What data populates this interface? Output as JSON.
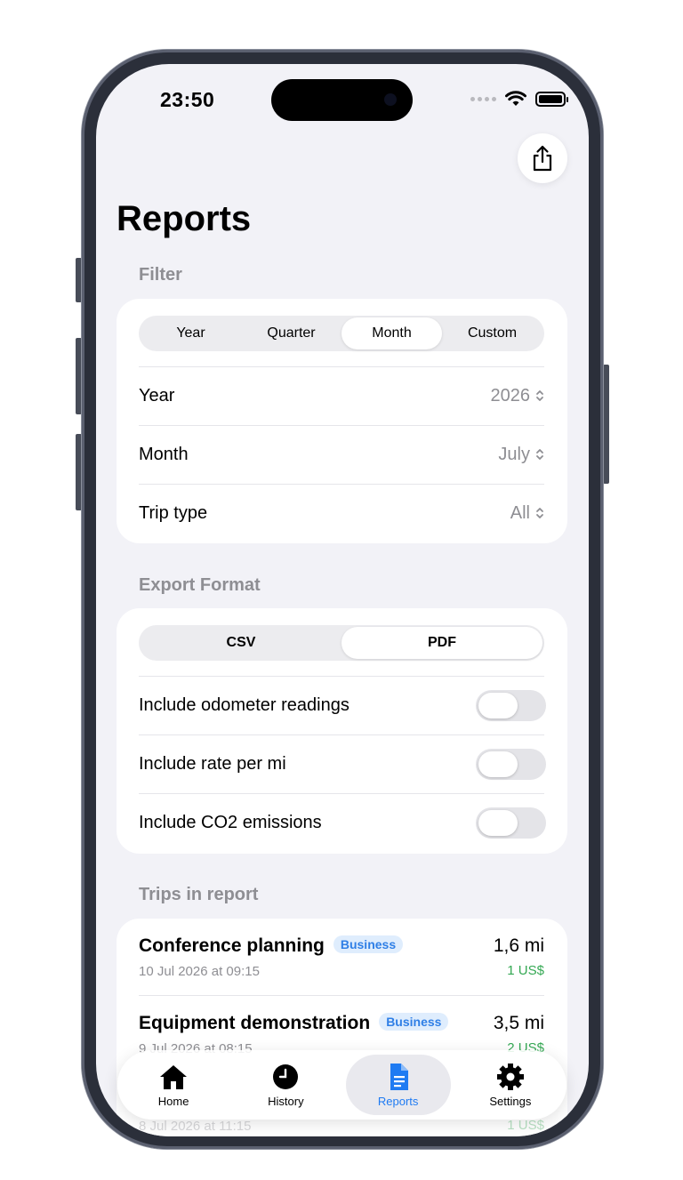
{
  "status_bar": {
    "time": "23:50"
  },
  "page": {
    "title": "Reports",
    "share_icon": "share-icon"
  },
  "filter": {
    "section_label": "Filter",
    "segments": [
      "Year",
      "Quarter",
      "Month",
      "Custom"
    ],
    "selected_segment": "Month",
    "rows": [
      {
        "label": "Year",
        "value": "2026"
      },
      {
        "label": "Month",
        "value": "July"
      },
      {
        "label": "Trip type",
        "value": "All"
      }
    ]
  },
  "export": {
    "section_label": "Export Format",
    "formats": [
      "CSV",
      "PDF"
    ],
    "selected_format": "PDF",
    "options": [
      {
        "label": "Include odometer readings",
        "enabled": false
      },
      {
        "label": "Include rate per mi",
        "enabled": false
      },
      {
        "label": "Include CO2 emissions",
        "enabled": false
      }
    ]
  },
  "trips": {
    "section_label": "Trips in report",
    "items": [
      {
        "name": "Conference planning",
        "badge": "Business",
        "date": "10 Jul 2026 at 09:15",
        "distance": "1,6 mi",
        "cost": "1 US$"
      },
      {
        "name": "Equipment demonstration",
        "badge": "Business",
        "date": "9 Jul 2026 at 08:15",
        "distance": "3,5 mi",
        "cost": "2 US$"
      },
      {
        "name": "",
        "badge": "",
        "date": "8 Jul 2026 at 11:15",
        "distance": "",
        "cost": "1 US$"
      }
    ]
  },
  "tab_bar": {
    "items": [
      {
        "label": "Home",
        "icon": "house-icon"
      },
      {
        "label": "History",
        "icon": "clock-icon"
      },
      {
        "label": "Reports",
        "icon": "document-icon"
      },
      {
        "label": "Settings",
        "icon": "gear-icon"
      }
    ],
    "active": "Reports"
  },
  "colors": {
    "accent": "#1f7bf2",
    "badge_text": "#2f7fe6",
    "cost": "#34a853",
    "background": "#f2f2f7"
  }
}
